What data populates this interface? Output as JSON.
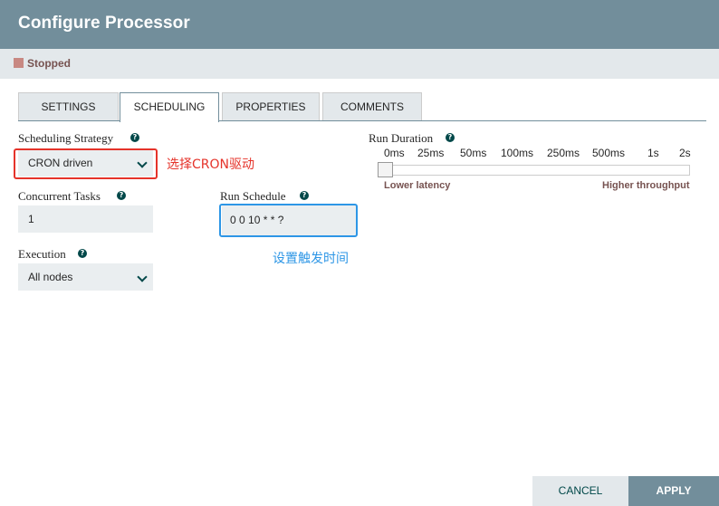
{
  "dialog": {
    "title": "Configure Processor",
    "status": "Stopped"
  },
  "tabs": [
    {
      "label": "SETTINGS"
    },
    {
      "label": "SCHEDULING"
    },
    {
      "label": "PROPERTIES"
    },
    {
      "label": "COMMENTS"
    }
  ],
  "scheduling_strategy": {
    "label": "Scheduling Strategy",
    "value": "CRON driven",
    "annotation": "选择CRON驱动"
  },
  "concurrent_tasks": {
    "label": "Concurrent Tasks",
    "value": "1"
  },
  "run_schedule": {
    "label": "Run Schedule",
    "value": "0 0 10 * * ?",
    "annotation": "设置触发时间"
  },
  "execution": {
    "label": "Execution",
    "value": "All nodes"
  },
  "run_duration": {
    "label": "Run Duration",
    "ticks": [
      "0ms",
      "25ms",
      "50ms",
      "100ms",
      "250ms",
      "500ms",
      "1s",
      "2s"
    ],
    "selected": "0ms",
    "low_label": "Lower latency",
    "high_label": "Higher throughput"
  },
  "help_icon_glyph": "?",
  "colors": {
    "header": "#728e9b",
    "annotation_red": "#e5332a",
    "annotation_blue": "#2d96e6"
  },
  "buttons": {
    "cancel": "CANCEL",
    "apply": "APPLY"
  }
}
